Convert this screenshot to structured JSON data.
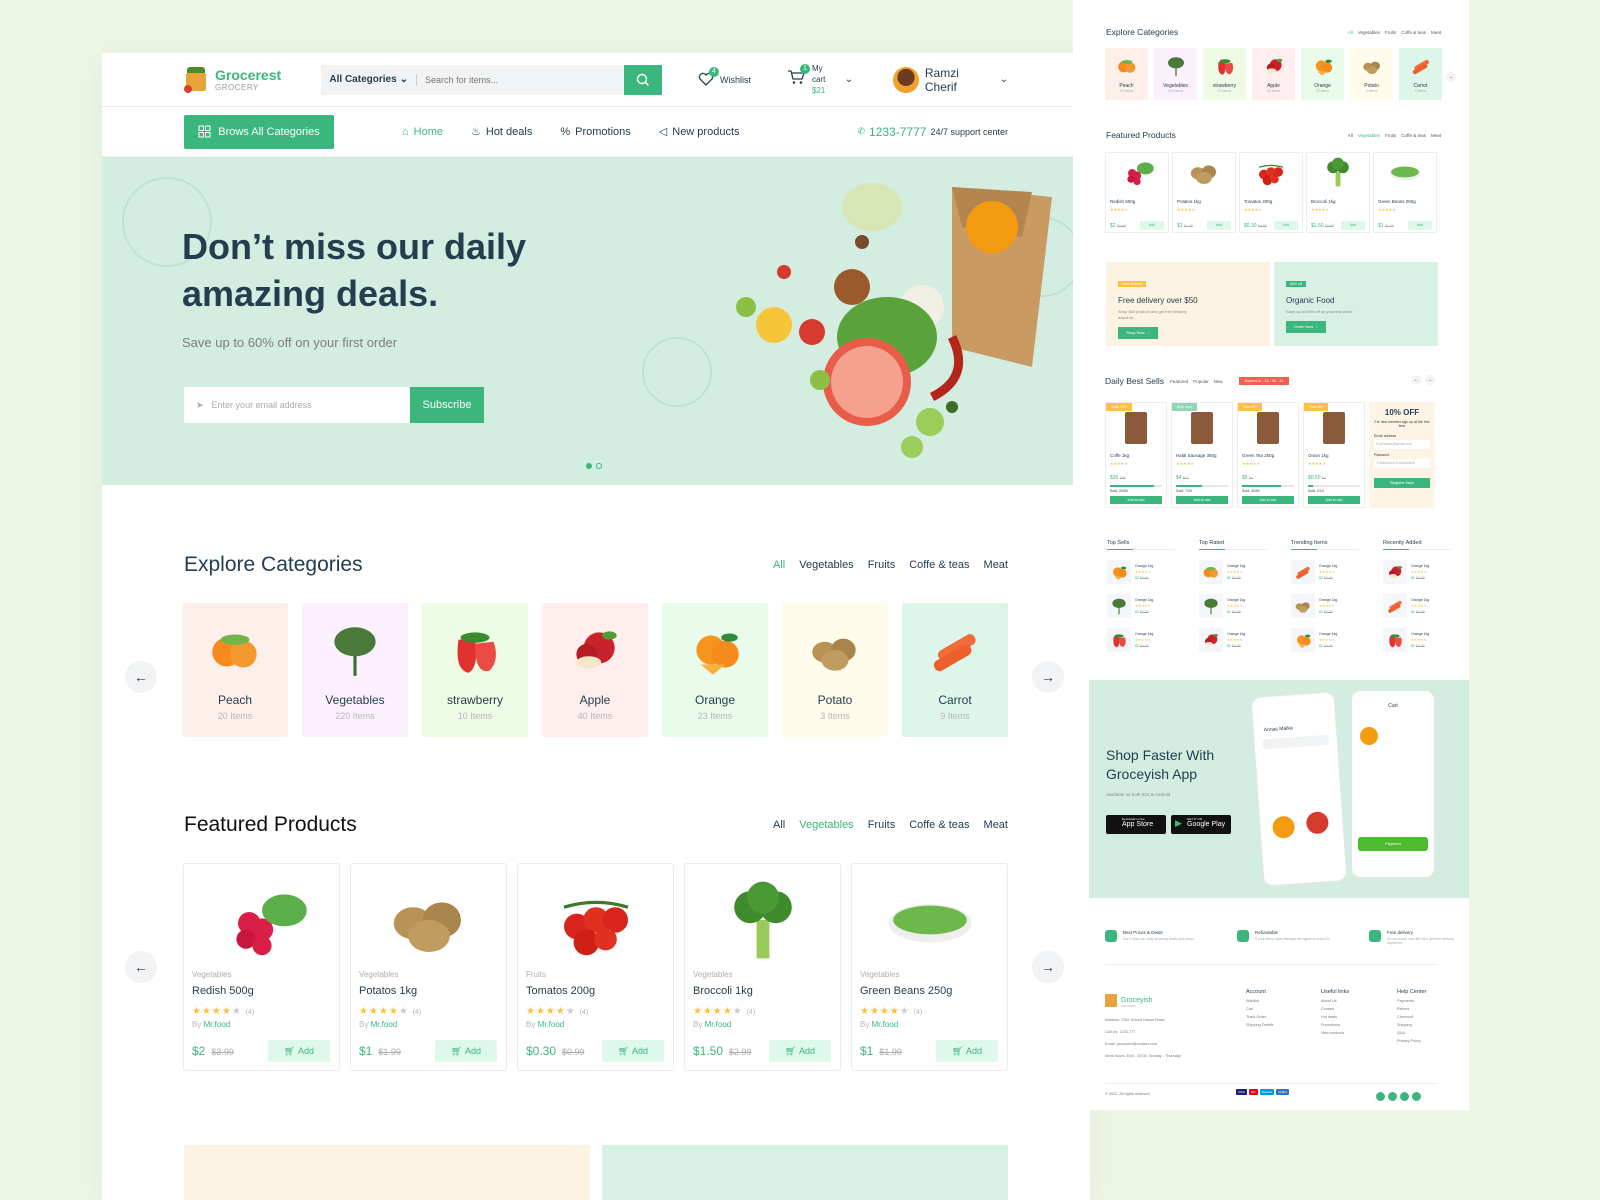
{
  "header": {
    "brand": "Grocerest",
    "brand_sub": "GROCERY",
    "search_category": "All Categories",
    "search_placeholder": "Search for items...",
    "wishlist_label": "Wishlist",
    "wishlist_count": "4",
    "cart_label": "My cart",
    "cart_total": "$21",
    "cart_count": "1",
    "user_name": "Ramzi Cherif"
  },
  "nav": {
    "browse_label": "Brows All Categories",
    "links": [
      "Home",
      "Hot deals",
      "Promotions",
      "New products"
    ],
    "active": "Home",
    "phone": "1233-7777",
    "support": "24/7 support center"
  },
  "hero": {
    "title": "Don’t miss our daily amazing deals.",
    "subtitle": "Save up to 60% off on your first order",
    "email_placeholder": "Enter your email address",
    "subscribe_label": "Subscribe",
    "slide_index": 1,
    "slide_count": 2
  },
  "explore": {
    "title": "Explore Categories",
    "tabs": [
      "All",
      "Vegetables",
      "Fruits",
      "Coffe & teas",
      "Meat"
    ],
    "active_tab": "All",
    "items": [
      {
        "name": "Peach",
        "count": "20 Items",
        "bg": "#fdefea",
        "icon": "peach"
      },
      {
        "name": "Vegetables",
        "count": "220 Items",
        "bg": "#fcf0fe",
        "icon": "greens"
      },
      {
        "name": "strawberry",
        "count": "10 Items",
        "bg": "#eefbe5",
        "icon": "strawberry"
      },
      {
        "name": "Apple",
        "count": "40 Items",
        "bg": "#feefee",
        "icon": "apple"
      },
      {
        "name": "Orange",
        "count": "23 Items",
        "bg": "#e9fbea",
        "icon": "orange"
      },
      {
        "name": "Potato",
        "count": "3 Items",
        "bg": "#fffceb",
        "icon": "potato"
      },
      {
        "name": "Carrot",
        "count": "9 Items",
        "bg": "#ddf6ea",
        "icon": "carrot"
      }
    ]
  },
  "featured": {
    "title": "Featured Products",
    "tabs": [
      "All",
      "Vegetables",
      "Fruits",
      "Coffe & teas",
      "Meat"
    ],
    "active_tab": "Vegetables",
    "by_label": "By",
    "vendor": "Mr.food",
    "add_label": "Add",
    "items": [
      {
        "category": "Vegetables",
        "name": "Redish 500g",
        "rating": 4,
        "reviews": "(4)",
        "price": "$2",
        "old_price": "$3.99",
        "icon": "radish"
      },
      {
        "category": "Vegetables",
        "name": "Potatos 1kg",
        "rating": 4,
        "reviews": "(4)",
        "price": "$1",
        "old_price": "$1.99",
        "icon": "potato"
      },
      {
        "category": "Fruits",
        "name": "Tomatos 200g",
        "rating": 4,
        "reviews": "(4)",
        "price": "$0.30",
        "old_price": "$0.99",
        "icon": "tomato"
      },
      {
        "category": "Vegetables",
        "name": "Broccoli 1kg",
        "rating": 4,
        "reviews": "(4)",
        "price": "$1.50",
        "old_price": "$2.99",
        "icon": "broccoli"
      },
      {
        "category": "Vegetables",
        "name": "Green Beans 250g",
        "rating": 4,
        "reviews": "(4)",
        "price": "$1",
        "old_price": "$1.99",
        "icon": "beans"
      }
    ]
  },
  "side": {
    "promos": [
      {
        "tag": "Free delivery",
        "title": "Free delivery over $50",
        "text": "Shop $50 product and get free delivery anywhre.",
        "button": "Shop Now",
        "bg": "#fdf3e2",
        "tagbg": "#fdc040"
      },
      {
        "tag": "60% off",
        "title": "Organic Food",
        "text": "Save up to 60% off on your first order",
        "button": "Order Now",
        "bg": "#d8f1e5",
        "tagbg": "#3bb77e"
      }
    ],
    "daily": {
      "title": "Daily Best Sells",
      "tabs": [
        "Featured",
        "Popular",
        "New"
      ],
      "expires_label": "Expires in :",
      "timer": "10 : 56 : 21",
      "add_label": "Add to cart",
      "items": [
        {
          "tag": "Save 10%",
          "category": "Coffe & teas",
          "name": "Coffe 1kg",
          "price": "$20",
          "old": "$25",
          "sold": "Sold: 20/50",
          "progress": 0.85,
          "tagbg": "#fdc040"
        },
        {
          "tag": "Best deal",
          "category": "Meat",
          "name": "Halal Sausage 350g",
          "price": "$4",
          "old": "$10",
          "sold": "Sold: 7/20",
          "progress": 0.5,
          "tagbg": "#8fd6b2"
        },
        {
          "tag": "Save 8%",
          "category": "Coffe & Teas",
          "name": "Green Tea 250g",
          "price": "$5",
          "old": "$7",
          "sold": "Sold: 33/50",
          "progress": 0.75,
          "tagbg": "#fdc040"
        },
        {
          "tag": "Save 8%",
          "category": "Vegetables",
          "name": "Onion 1kg",
          "price": "$0.50",
          "old": "$1",
          "sold": "Sold: 2/10",
          "progress": 0.1,
          "tagbg": "#fdc040"
        }
      ],
      "offer": {
        "title": "10% OFF",
        "text": "For new member sign up at the first time",
        "email_label": "Email address",
        "email_placeholder": "johndoe@gmail.com",
        "password_label": "Password",
        "password_placeholder": "Maximum 8 characters",
        "button": "Register Now"
      }
    },
    "lists": [
      {
        "title": "Top Sells",
        "items": [
          "Orange 1kg",
          "Orange 1kg",
          "Orange 1kg"
        ]
      },
      {
        "title": "Top Rated",
        "items": [
          "Orange 1kg",
          "Orange 1kg",
          "Orange 1kg"
        ]
      },
      {
        "title": "Trending Items",
        "items": [
          "Orange 1kg",
          "Orange 1kg",
          "Orange 1kg"
        ]
      },
      {
        "title": "Recently Added",
        "items": [
          "Orange 1kg",
          "Orange 1kg",
          "Orange 1kg"
        ]
      }
    ],
    "list_price": "$2",
    "list_old": "$3.99",
    "app": {
      "title": "Shop Faster With Groceyish App",
      "subtitle": "Available on both IOS & Android",
      "appstore_small": "Download on the",
      "appstore": "App Store",
      "gplay_small": "GET IT ON",
      "gplay": "Google Play",
      "phone_user": "Annas Malka",
      "phone_cart": "Cart",
      "phone_pay": "Payment"
    },
    "features": [
      {
        "title": "Best Prices & Deals",
        "text": "Don't miss our daily amazing deals and prices"
      },
      {
        "title": "Refundable",
        "text": "If your items have damage we agree to refund it"
      },
      {
        "title": "Free delivery",
        "text": "Do purchase over $50 and get free delivery anywhere"
      }
    ],
    "footer": {
      "brand": "Groceyish",
      "brand_sub": "GROCERY",
      "address": "Address: 1762 School House Road",
      "call": "Call Us: 1233-777",
      "email": "Email: groceyish@contact.com",
      "hours": "Work hours: 8:00 - 20:00, Sunday - Thursday",
      "columns": [
        {
          "title": "Account",
          "links": [
            "Wishlist",
            "Cart",
            "Track Order",
            "Shipping Details"
          ]
        },
        {
          "title": "Useful links",
          "links": [
            "About Us",
            "Contact",
            "Hot deals",
            "Promotions",
            "New products"
          ]
        },
        {
          "title": "Help Center",
          "links": [
            "Payments",
            "Refund",
            "Checkout",
            "Shipping",
            "Q&A",
            "Privacy Policy"
          ]
        }
      ],
      "copyright": "© 2022, All rights reserved",
      "payments": [
        "VISA",
        "MC",
        "Maestro",
        "AMEX"
      ]
    }
  }
}
